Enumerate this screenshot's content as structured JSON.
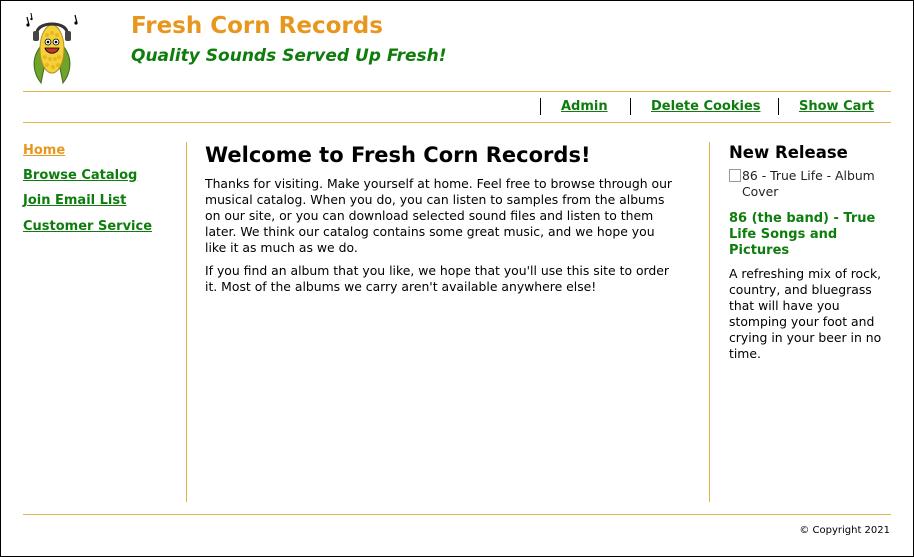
{
  "header": {
    "logo_icon": "corn-mascot-icon",
    "title": "Fresh Corn Records",
    "tagline": "Quality Sounds Served Up Fresh!"
  },
  "top_nav": [
    {
      "label": "Admin"
    },
    {
      "label": "Delete Cookies"
    },
    {
      "label": "Show Cart"
    }
  ],
  "left_nav": [
    {
      "label": "Home",
      "active": true
    },
    {
      "label": "Browse Catalog"
    },
    {
      "label": "Join Email List"
    },
    {
      "label": "Customer Service"
    }
  ],
  "main": {
    "heading": "Welcome to Fresh Corn Records!",
    "paragraphs": [
      "Thanks for visiting. Make yourself at home. Feel free to browse through our musical catalog. When you do, you can listen to samples from the albums on our site, or you can download selected sound files and listen to them later. We think our catalog contains some great music, and we hope you like it as much as we do.",
      "If you find an album that you like, we hope that you'll use this site to order it. Most of the albums we carry aren't available anywhere else!"
    ]
  },
  "sidebar": {
    "heading": "New Release",
    "image_alt": "86 - True Life - Album Cover",
    "album_title": "86 (the band) - True Life Songs and Pictures",
    "description": "A refreshing mix of rock, country, and bluegrass that will have you stomping your foot and crying in your beer in no time."
  },
  "footer": {
    "copyright": "© Copyright 2021"
  },
  "colors": {
    "brand_orange": "#e8971e",
    "brand_green": "#0e7d0e",
    "rule_gold": "#e0b54a"
  }
}
